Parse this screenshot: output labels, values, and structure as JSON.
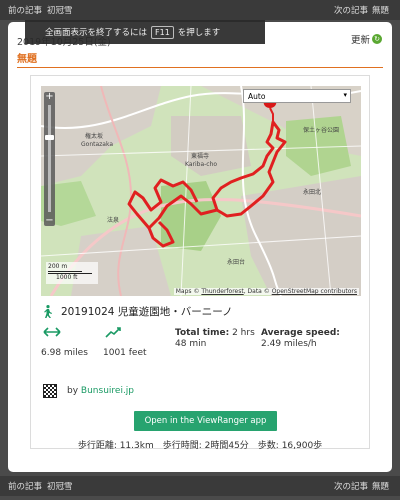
{
  "nav": {
    "prev": "前の記事",
    "prev_title": "初冠雪",
    "next": "次の記事",
    "next_title": "無題"
  },
  "post": {
    "date": "2019年10月25日(金)",
    "refresh": "更新",
    "title": "無題"
  },
  "fullscreen_hint": {
    "text_before": "全画面表示を終了するには",
    "key": "F11",
    "text_after": "を押します"
  },
  "map": {
    "type_select": "Auto",
    "scale_m": "200 m",
    "scale_ft": "1000 ft",
    "attribution_prefix": "Maps ©",
    "attribution_link1": "Thunderforest",
    "attribution_mid": ", Data ©",
    "attribution_link2": "OpenStreetMap contributors",
    "labels": [
      "Gontazaka",
      "Kariba-cho",
      "権太坂",
      "東福寺",
      "永田台",
      "永田北",
      "法泉",
      "保土ヶ谷公園"
    ]
  },
  "route": {
    "title": "20191024 児童遊園地・バーニーノ",
    "distance": "6.98 miles",
    "ascent": "1001 feet",
    "total_time_label": "Total time:",
    "total_time_value": "2 hrs 48 min",
    "avg_speed_label": "Average speed:",
    "avg_speed_value": "2.49 miles/h",
    "by_prefix": "by",
    "author": "Bunsuirei.jp",
    "open_button": "Open in the ViewRanger app"
  },
  "summary": "歩行距離: 11.3km　歩行時間: 2時間45分　歩数: 16,900歩",
  "colors": {
    "accent_orange": "#e07020",
    "button_green": "#27a36f",
    "route_red": "#e02020",
    "map_green": "#c8e0b0"
  }
}
